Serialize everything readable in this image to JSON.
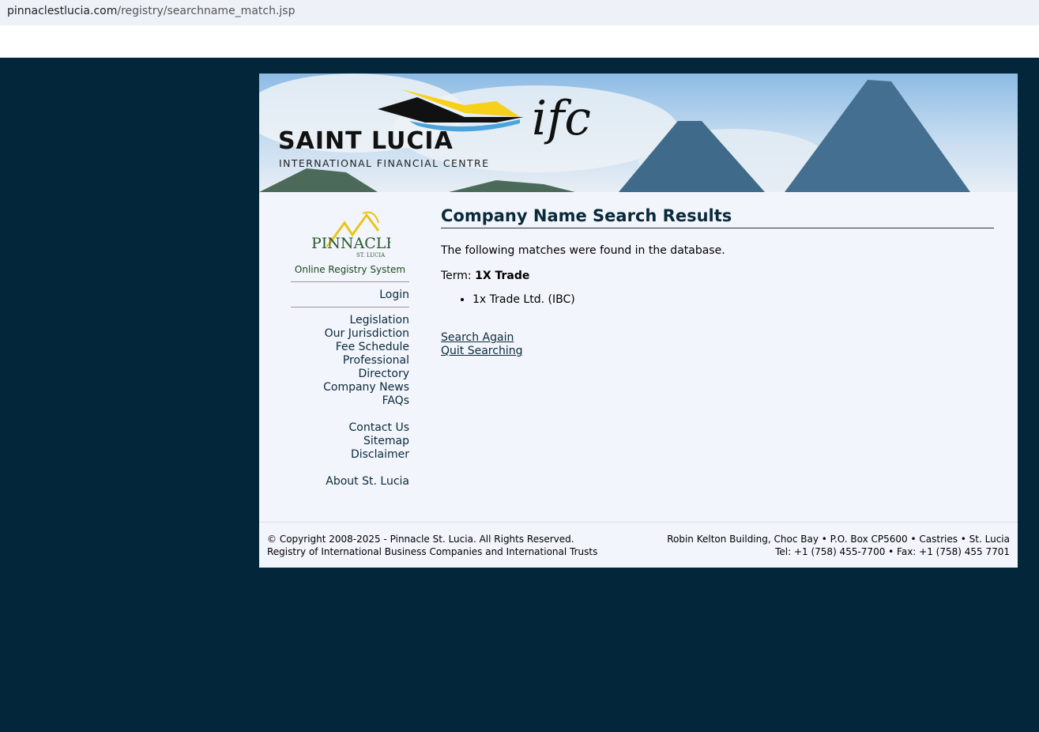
{
  "browser": {
    "url_host": "pinnaclestlucia.com",
    "url_path": "/registry/searchname_match.jsp"
  },
  "banner": {
    "title": "SAINT LUCIA",
    "subtitle": "INTERNATIONAL FINANCIAL CENTRE",
    "mark": "ifc"
  },
  "sidebar": {
    "logo_text": "PINNACLE",
    "logo_sub": "ST. LUCIA",
    "system_name": "Online Registry System",
    "login": "Login",
    "group1": [
      "Legislation",
      "Our Jurisdiction",
      "Fee Schedule",
      "Professional Directory",
      "Company News",
      "FAQs"
    ],
    "group2": [
      "Contact Us",
      "Sitemap",
      "Disclaimer"
    ],
    "group3": [
      "About St. Lucia"
    ]
  },
  "main": {
    "title": "Company Name Search Results",
    "intro": "The following matches were found in the database.",
    "term_label": "Term:",
    "term_value": "1X Trade",
    "results": [
      "1x Trade Ltd. (IBC)"
    ],
    "search_again": "Search Again",
    "quit": "Quit Searching"
  },
  "footer": {
    "copyright": "© Copyright 2008-2025 - Pinnacle St. Lucia. All Rights Reserved.",
    "registry": "Registry of International Business Companies and International Trusts",
    "address": "Robin Kelton Building, Choc Bay • P.O. Box CP5600 • Castries • St. Lucia",
    "phone": "Tel: +1 (758) 455-7700 • Fax: +1 (758) 455 7701"
  }
}
